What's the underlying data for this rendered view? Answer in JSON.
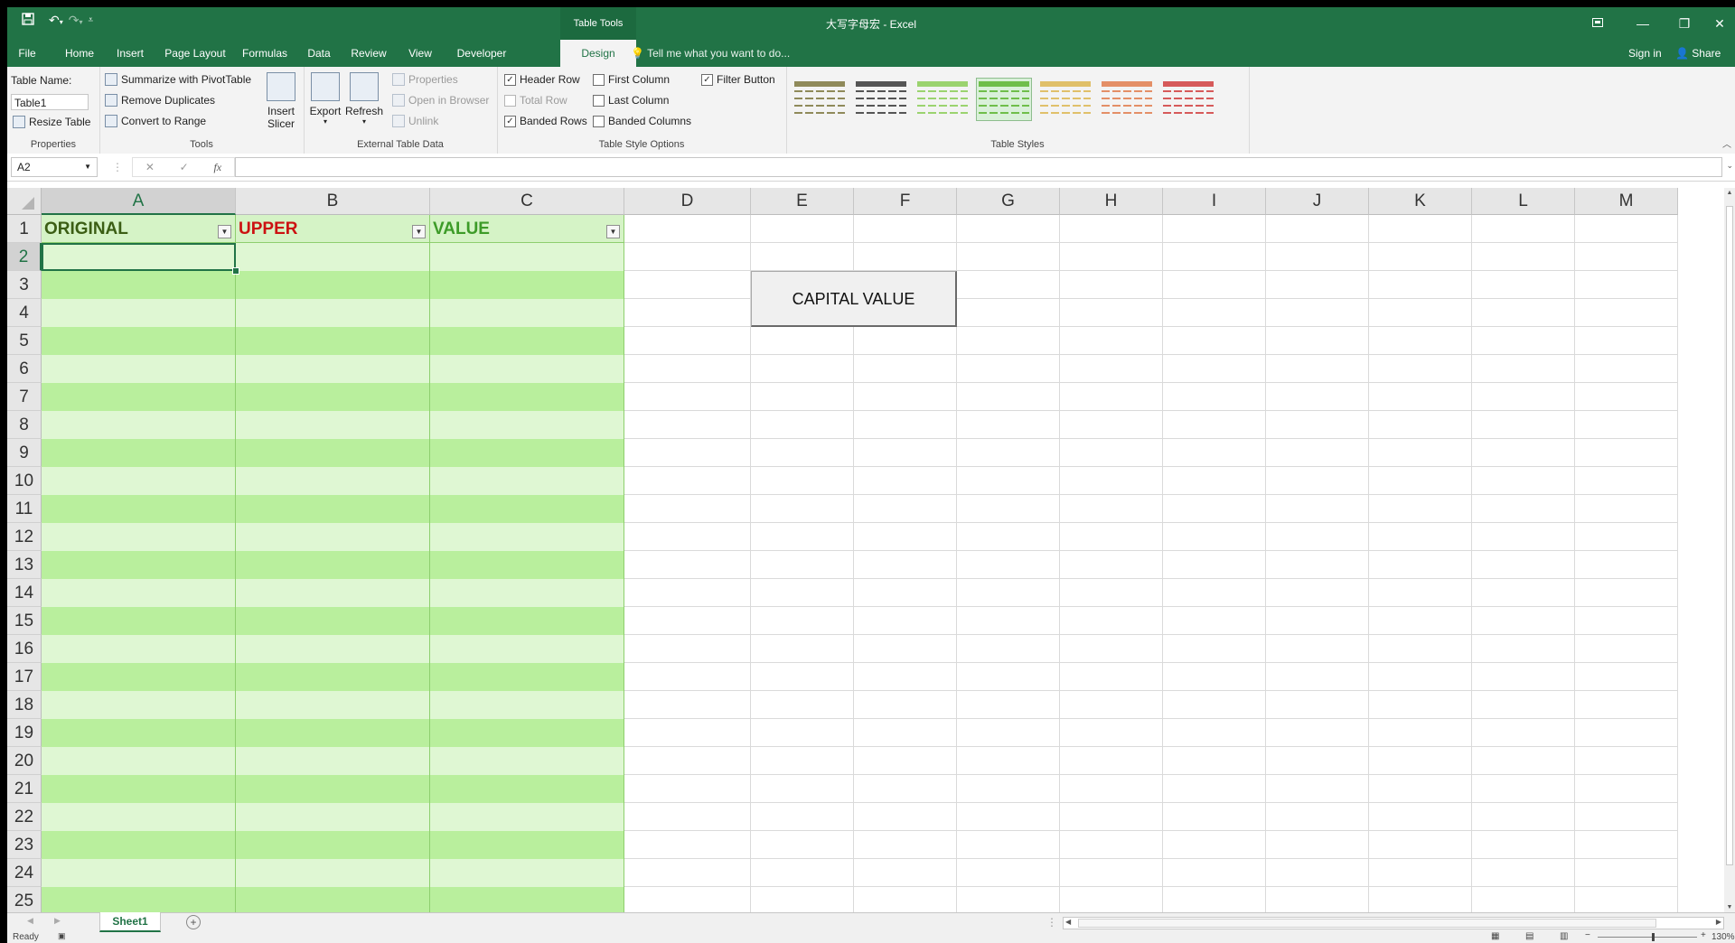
{
  "titlebar": {
    "context_tab": "Table Tools",
    "doc_title": "大写字母宏 - Excel",
    "qat_icons": [
      "save-icon",
      "undo-icon",
      "redo-icon",
      "customize-icon"
    ]
  },
  "tabs": [
    {
      "label": "File",
      "active": false
    },
    {
      "label": "Home",
      "active": false
    },
    {
      "label": "Insert",
      "active": false
    },
    {
      "label": "Page Layout",
      "active": false
    },
    {
      "label": "Formulas",
      "active": false
    },
    {
      "label": "Data",
      "active": false
    },
    {
      "label": "Review",
      "active": false
    },
    {
      "label": "View",
      "active": false
    },
    {
      "label": "Developer",
      "active": false
    },
    {
      "label": "Design",
      "active": true
    }
  ],
  "tellme": "Tell me what you want to do...",
  "account": {
    "signin": "Sign in",
    "share": "Share"
  },
  "ribbon": {
    "properties": {
      "label": "Properties",
      "table_name_label": "Table Name:",
      "table_name_value": "Table1",
      "resize": "Resize Table"
    },
    "tools": {
      "label": "Tools",
      "summarize": "Summarize with PivotTable",
      "remove_dup": "Remove Duplicates",
      "convert": "Convert to Range",
      "insert_slicer": "Insert Slicer"
    },
    "external": {
      "label": "External Table Data",
      "export": "Export",
      "refresh": "Refresh",
      "properties": "Properties",
      "open_browser": "Open in Browser",
      "unlink": "Unlink"
    },
    "style_options": {
      "label": "Table Style Options",
      "header_row": "Header Row",
      "total_row": "Total Row",
      "banded_rows": "Banded Rows",
      "first_column": "First Column",
      "last_column": "Last Column",
      "banded_columns": "Banded Columns",
      "filter_button": "Filter Button",
      "checked": {
        "header_row": true,
        "total_row": false,
        "banded_rows": true,
        "first_column": false,
        "last_column": false,
        "banded_columns": false,
        "filter_button": true
      }
    },
    "styles": {
      "label": "Table Styles",
      "swatch_colors": [
        "#8f8a5a",
        "#555555",
        "#9bd36f",
        "#6fbe4a",
        "#e0c06a",
        "#e48f67",
        "#d65a5a"
      ],
      "selected_index": 3
    }
  },
  "formula_bar": {
    "name_box": "A2",
    "formula": ""
  },
  "sheet": {
    "columns": [
      "A",
      "B",
      "C",
      "D",
      "E",
      "F",
      "G",
      "H",
      "I",
      "J",
      "K",
      "L",
      "M"
    ],
    "selected_column": "A",
    "rows": [
      "1",
      "2",
      "3",
      "4",
      "5",
      "6",
      "7",
      "8",
      "9",
      "10",
      "11",
      "12",
      "13",
      "14",
      "15",
      "16",
      "17",
      "18",
      "19",
      "20",
      "21",
      "22",
      "23",
      "24",
      "25"
    ],
    "selected_row": "2",
    "table_headers": [
      {
        "text": "ORIGINAL",
        "color": "#3b5e14"
      },
      {
        "text": "UPPER",
        "color": "#cc1111"
      },
      {
        "text": "VALUE",
        "color": "#3d9b28"
      }
    ],
    "band_colors": {
      "light": "#dff7d3",
      "dark": "#b9ef9d"
    },
    "button_label": "CAPITAL VALUE"
  },
  "sheet_tabs": {
    "active": "Sheet1"
  },
  "status": {
    "ready": "Ready",
    "zoom": "130%"
  }
}
